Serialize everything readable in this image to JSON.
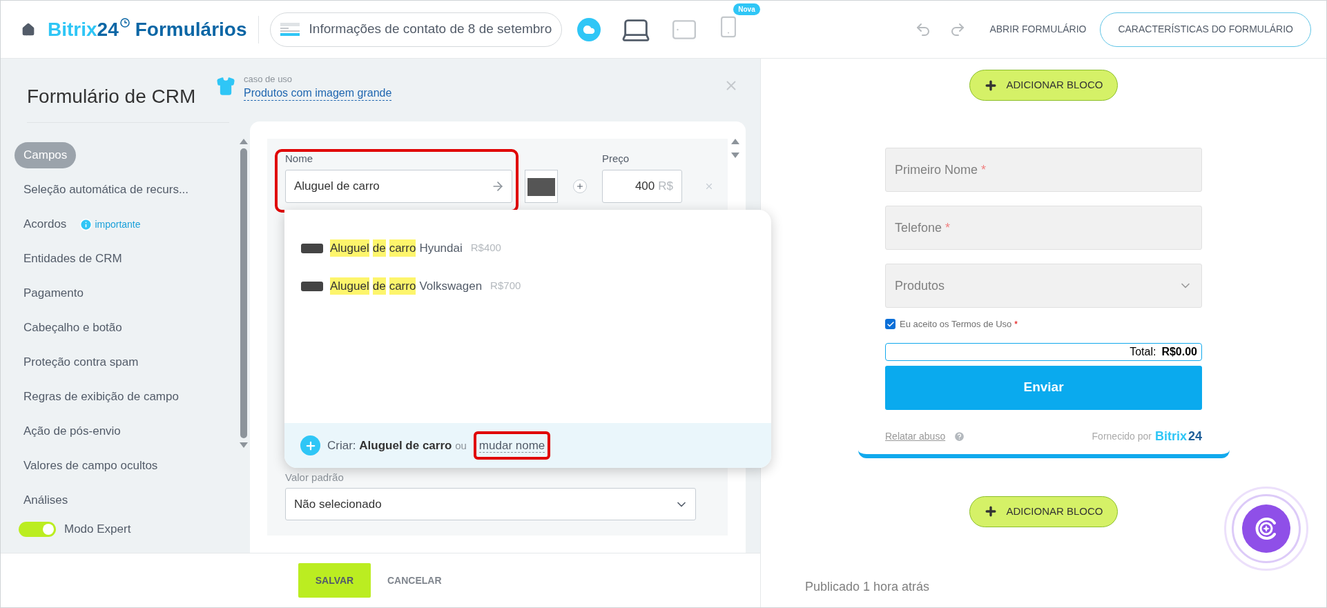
{
  "header": {
    "logo": {
      "brand": "Bitrix",
      "number": "24",
      "product": "Formulários"
    },
    "form_selector": "Informações de contato de 8 de setembro",
    "devices": [
      {
        "kind": "cloud",
        "selected": false
      },
      {
        "kind": "laptop",
        "selected": true
      },
      {
        "kind": "tablet",
        "selected": false
      },
      {
        "kind": "phone",
        "selected": false,
        "badge": "Nova"
      }
    ],
    "open_form": "ABRIR FORMULÁRIO",
    "characteristics": "CARACTERÍSTICAS DO FORMULÁRIO"
  },
  "sidebar": {
    "title": "Formulário de CRM",
    "use_case_label": "caso de uso",
    "use_case_link": "Produtos com imagem grande",
    "items": [
      {
        "label": "Campos",
        "selected": true
      },
      {
        "label": "Seleção automática de recurs...",
        "selected": false
      },
      {
        "label": "Acordos",
        "selected": false,
        "badge": "importante"
      },
      {
        "label": "Entidades de CRM",
        "selected": false
      },
      {
        "label": "Pagamento",
        "selected": false
      },
      {
        "label": "Cabeçalho e botão",
        "selected": false
      },
      {
        "label": "Proteção contra spam",
        "selected": false
      },
      {
        "label": "Regras de exibição de campo",
        "selected": false
      },
      {
        "label": "Ação de pós-envio",
        "selected": false
      },
      {
        "label": "Valores de campo ocultos",
        "selected": false
      },
      {
        "label": "Análises",
        "selected": false
      }
    ],
    "expert_mode": {
      "label": "Modo Expert",
      "on": true
    }
  },
  "product": {
    "name_label": "Nome",
    "name_value": "Aluguel de carro",
    "price_label": "Preço",
    "price_value": "400",
    "currency": "R$"
  },
  "suggestions": [
    {
      "match": [
        "Aluguel",
        "de",
        "carro"
      ],
      "rest": "Hyundai",
      "price": "R$400"
    },
    {
      "match": [
        "Aluguel",
        "de",
        "carro"
      ],
      "rest": "Volkswagen",
      "price": "R$700"
    }
  ],
  "create": {
    "prefix": "Criar:",
    "name": "Aluguel de carro",
    "or": "ou",
    "link": "mudar nome"
  },
  "default_value": {
    "label": "Valor padrão",
    "value": "Não selecionado"
  },
  "footer": {
    "save": "SALVAR",
    "cancel": "CANCELAR"
  },
  "preview": {
    "add_block": "ADICIONAR BLOCO",
    "add_block_bottom": "ADICIONAR BLOCO",
    "fields": [
      {
        "kind": "text",
        "placeholder": "Primeiro Nome",
        "mark": "*"
      },
      {
        "kind": "text",
        "placeholder": "Telefone",
        "mark": "*"
      },
      {
        "kind": "select",
        "placeholder": "Produtos"
      }
    ],
    "terms": {
      "label": "Eu aceito os Termos de Uso",
      "mark": "*",
      "checked": true
    },
    "total_label": "Total:",
    "total_value": "R$0.00",
    "submit": "Enviar",
    "report": "Relatar abuso",
    "powered_by": "Fornecido por",
    "powered_brand": "Bitrix",
    "powered_number": "24",
    "published": "Publicado 1 hora atrás"
  }
}
